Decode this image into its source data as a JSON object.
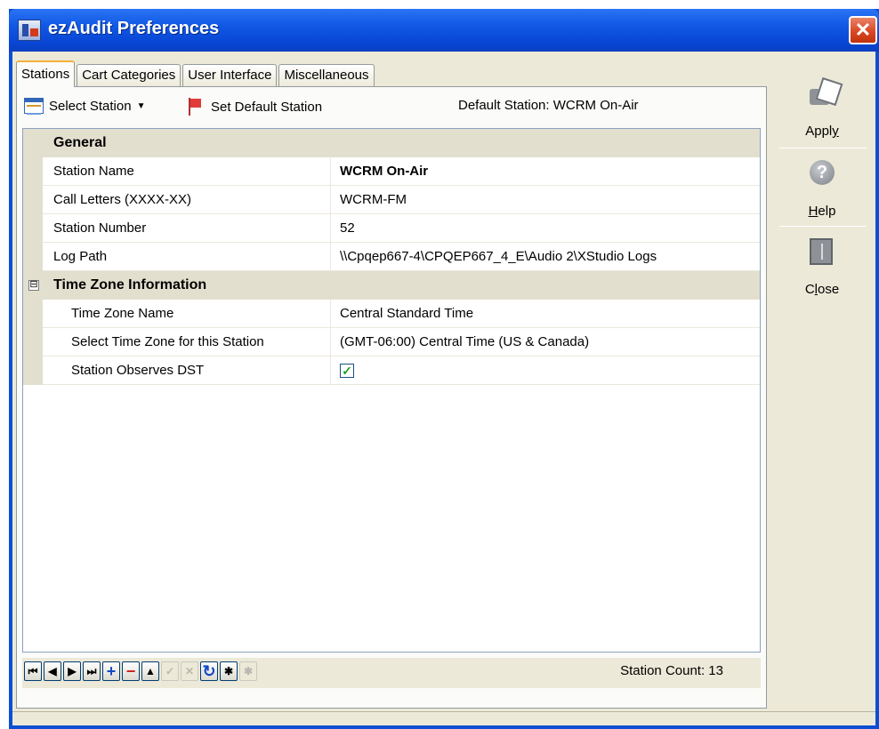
{
  "window": {
    "title": "ezAudit Preferences",
    "close_glyph": "✕"
  },
  "tabs": [
    {
      "label": "Stations",
      "active": true
    },
    {
      "label": "Cart Categories",
      "active": false
    },
    {
      "label": "User Interface",
      "active": false
    },
    {
      "label": "Miscellaneous",
      "active": false
    }
  ],
  "toolbar": {
    "select_station": "Select Station",
    "set_default": "Set Default Station",
    "default_station_text": "Default Station: WCRM On-Air"
  },
  "grid": {
    "general": {
      "label": "General",
      "rows": [
        {
          "name": "Station Name",
          "value": "WCRM On-Air"
        },
        {
          "name": "Call Letters (XXXX-XX)",
          "value": "WCRM-FM"
        },
        {
          "name": "Station Number",
          "value": "52"
        },
        {
          "name": "Log Path",
          "value": "\\\\Cpqep667-4\\CPQEP667_4_E\\Audio 2\\XStudio Logs"
        }
      ]
    },
    "timezone": {
      "label": "Time Zone Information",
      "expander": "⊟",
      "rows": [
        {
          "name": "Time Zone Name",
          "value": "Central Standard Time"
        },
        {
          "name": "Select Time Zone for this Station",
          "value": "(GMT-06:00) Central Time (US & Canada)"
        },
        {
          "name": "Station Observes DST",
          "checked": true,
          "check_glyph": "✓"
        }
      ]
    }
  },
  "navigator": {
    "buttons": [
      {
        "name": "first-record-button",
        "glyph": "⏮"
      },
      {
        "name": "prev-record-button",
        "glyph": "◀"
      },
      {
        "name": "next-record-button",
        "glyph": "▶"
      },
      {
        "name": "last-record-button",
        "glyph": "⏭"
      },
      {
        "name": "add-record-button",
        "glyph": "+"
      },
      {
        "name": "delete-record-button",
        "glyph": "−"
      },
      {
        "name": "edit-record-button",
        "glyph": "▲"
      },
      {
        "name": "post-record-button",
        "glyph": "✓"
      },
      {
        "name": "cancel-record-button",
        "glyph": "✕"
      },
      {
        "name": "refresh-button",
        "glyph": "↻"
      },
      {
        "name": "bookmark-button",
        "glyph": "✱"
      },
      {
        "name": "goto-bookmark-button",
        "glyph": "✱"
      }
    ],
    "count_text": "Station Count: 13"
  },
  "side": {
    "apply": {
      "label_pre": "Appl",
      "label_u": "y",
      "label_post": ""
    },
    "help": {
      "label_pre": "",
      "label_u": "H",
      "label_post": "elp",
      "icon_glyph": "?"
    },
    "close": {
      "label_pre": "C",
      "label_u": "l",
      "label_post": "ose"
    }
  },
  "colors": {
    "title_bar": "#0846d4",
    "client_bg": "#ece9d8",
    "grid_category": "#e3dfcf"
  }
}
